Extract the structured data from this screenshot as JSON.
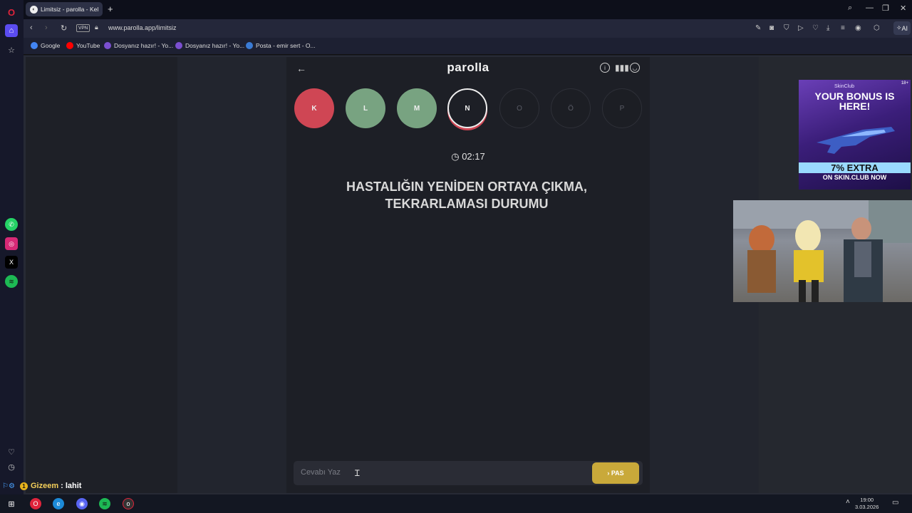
{
  "browser": {
    "tab_title": "Limitsiz - parolla - Kel",
    "url": "www.parolla.app/limitsiz",
    "vpn_label": "VPN",
    "ai_label": "AI",
    "bookmarks": [
      {
        "label": "Google",
        "color": "#4285f4"
      },
      {
        "label": "YouTube",
        "color": "#ff0000"
      },
      {
        "label": "Dosyanız hazır! - Yo...",
        "color": "#7b4fd0"
      },
      {
        "label": "Dosyanız hazır! - Yo...",
        "color": "#7b4fd0"
      },
      {
        "label": "Posta - emir sert - O...",
        "color": "#3a7bd5"
      }
    ]
  },
  "game": {
    "title": "parolla",
    "timer": "02:17",
    "letters": [
      {
        "letter": "K",
        "state": "wrong"
      },
      {
        "letter": "L",
        "state": "correct"
      },
      {
        "letter": "M",
        "state": "correct"
      },
      {
        "letter": "N",
        "state": "current"
      },
      {
        "letter": "O",
        "state": "pending"
      },
      {
        "letter": "Ö",
        "state": "pending"
      },
      {
        "letter": "P",
        "state": "pending"
      }
    ],
    "question": "HASTALIĞIN YENİDEN ORTAYA ÇIKMA, TEKRARLAMASI DURUMU",
    "answer_placeholder": "Cevabı Yaz",
    "pass_label": "PAS"
  },
  "ad": {
    "brand": "SkinClub",
    "age": "18+",
    "headline": "YOUR BONUS IS HERE!",
    "extra": "7% EXTRA",
    "footer": "ON SKIN.CLUB NOW"
  },
  "chat": {
    "badge": "1",
    "user": "Gizeem",
    "message": ": lahit"
  },
  "taskbar": {
    "time": "19:00",
    "date": "3.03.2026"
  },
  "colors": {
    "wrong": "#cf4654",
    "correct": "#78a381",
    "pass_button": "#c9a93a"
  }
}
